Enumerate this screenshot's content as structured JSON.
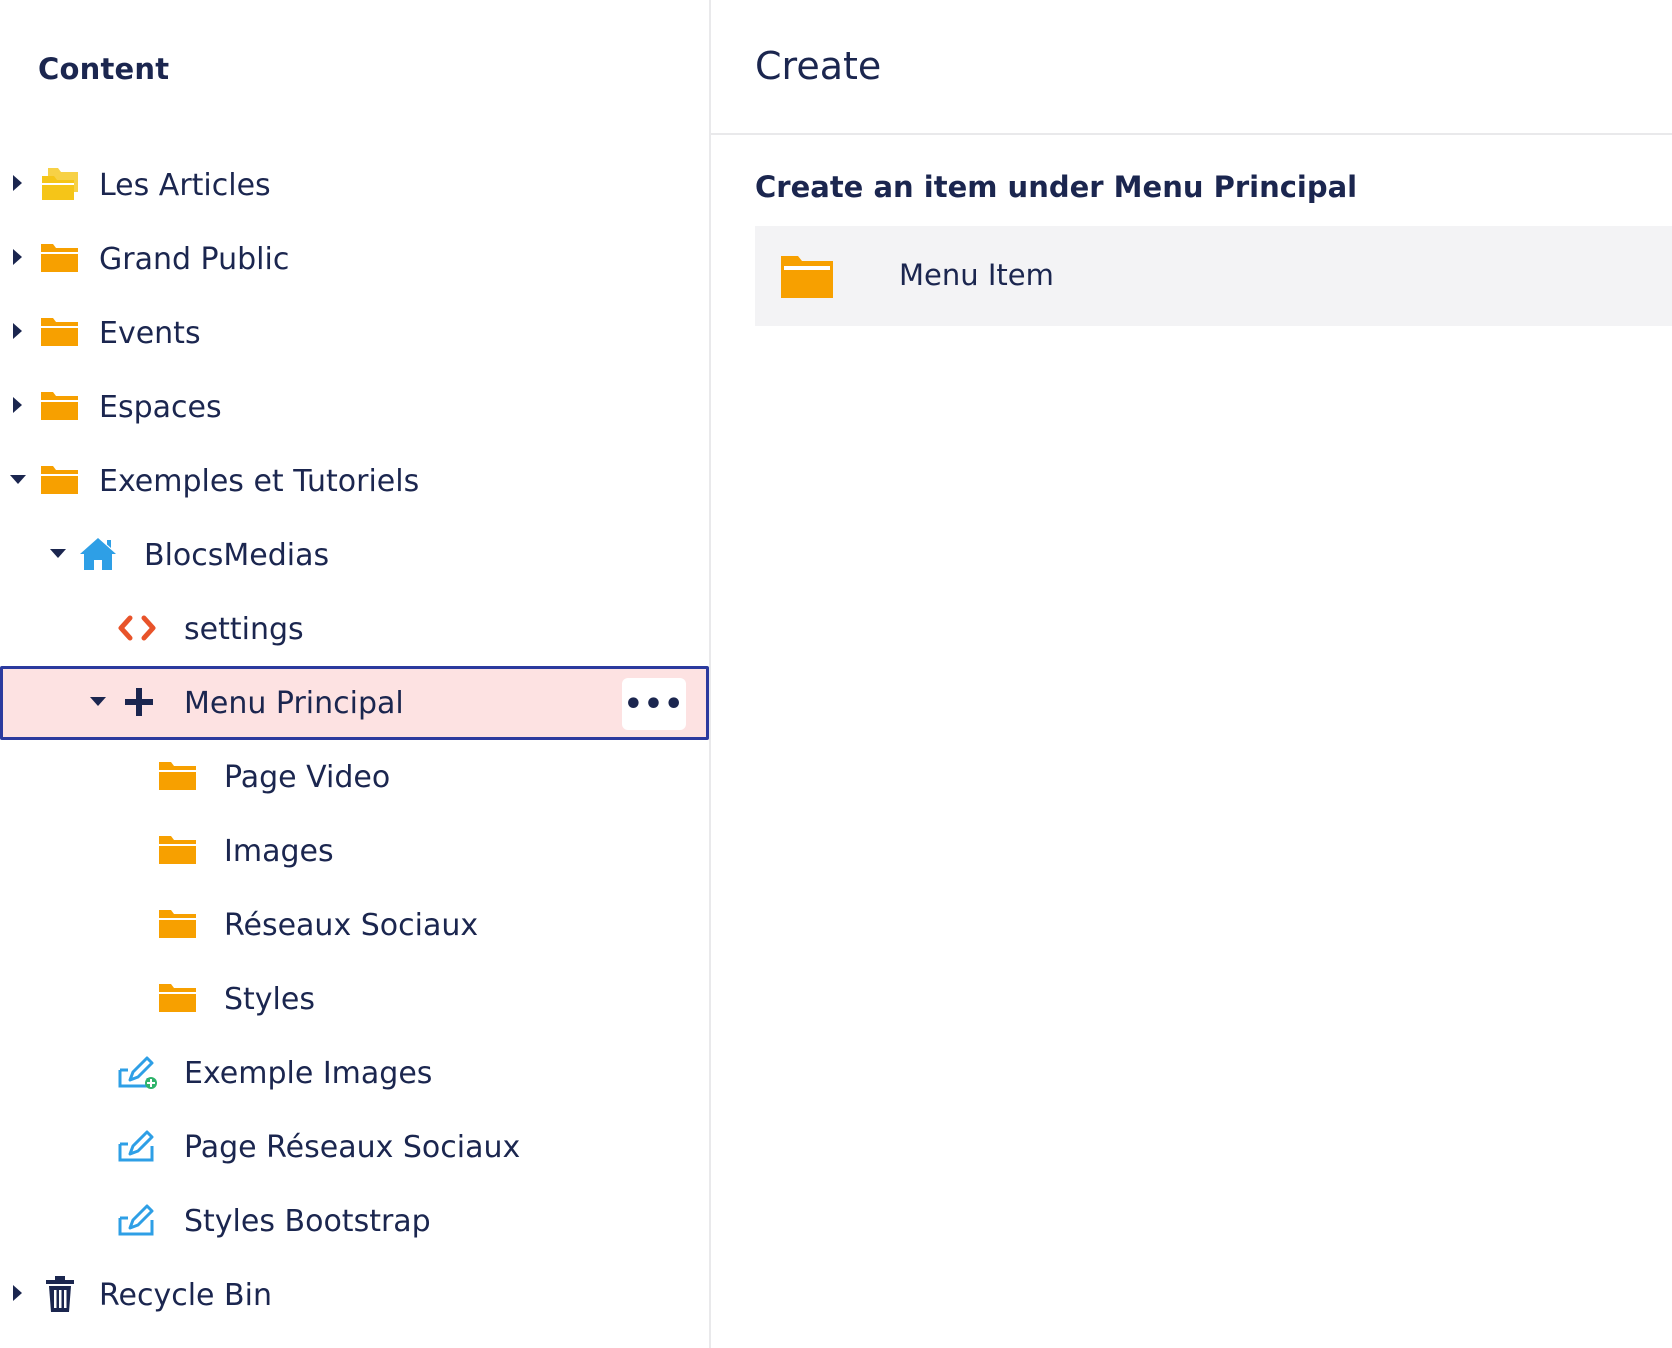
{
  "sidebar": {
    "title": "Content",
    "items": [
      {
        "label": "Les Articles",
        "icon": "folder-stack-icon",
        "caret": "right",
        "level": 0
      },
      {
        "label": "Grand Public",
        "icon": "folder-icon",
        "caret": "right",
        "level": 0
      },
      {
        "label": "Events",
        "icon": "folder-icon",
        "caret": "right",
        "level": 0
      },
      {
        "label": "Espaces",
        "icon": "folder-icon",
        "caret": "right",
        "level": 0
      },
      {
        "label": "Exemples et Tutoriels",
        "icon": "folder-icon",
        "caret": "down",
        "level": 0
      },
      {
        "label": "BlocsMedias",
        "icon": "home-icon",
        "caret": "down",
        "level": 1
      },
      {
        "label": "settings",
        "icon": "code-icon",
        "caret": "none",
        "level": 2
      },
      {
        "label": "Menu Principal",
        "icon": "plus-icon",
        "caret": "down",
        "level": 2,
        "selected": true,
        "more_label": "•••"
      },
      {
        "label": "Page Video",
        "icon": "folder-icon",
        "caret": "none",
        "level": 3
      },
      {
        "label": "Images",
        "icon": "folder-icon",
        "caret": "none",
        "level": 3
      },
      {
        "label": "Réseaux Sociaux",
        "icon": "folder-icon",
        "caret": "none",
        "level": 3
      },
      {
        "label": "Styles",
        "icon": "folder-icon",
        "caret": "none",
        "level": 3
      },
      {
        "label": "Exemple Images",
        "icon": "edit-plus-icon",
        "caret": "none",
        "level": 2
      },
      {
        "label": "Page Réseaux Sociaux",
        "icon": "edit-icon",
        "caret": "none",
        "level": 2
      },
      {
        "label": "Styles Bootstrap",
        "icon": "edit-icon",
        "caret": "none",
        "level": 2
      },
      {
        "label": "Recycle Bin",
        "icon": "trash-icon",
        "caret": "right",
        "level": 0
      }
    ]
  },
  "main": {
    "title": "Create",
    "heading": "Create an item under Menu Principal",
    "options": [
      {
        "label": "Menu Item",
        "icon": "folder-icon"
      }
    ]
  },
  "colors": {
    "text": "#1b264f",
    "folder": "#f7a000",
    "folder_stack": "#f5c518",
    "home": "#2e9fe6",
    "code": "#e8532a",
    "edit": "#2e9fe6",
    "edit_plus": "#2fb36b",
    "selected_bg": "#fde2e2",
    "selected_border": "#2b3a9e"
  }
}
